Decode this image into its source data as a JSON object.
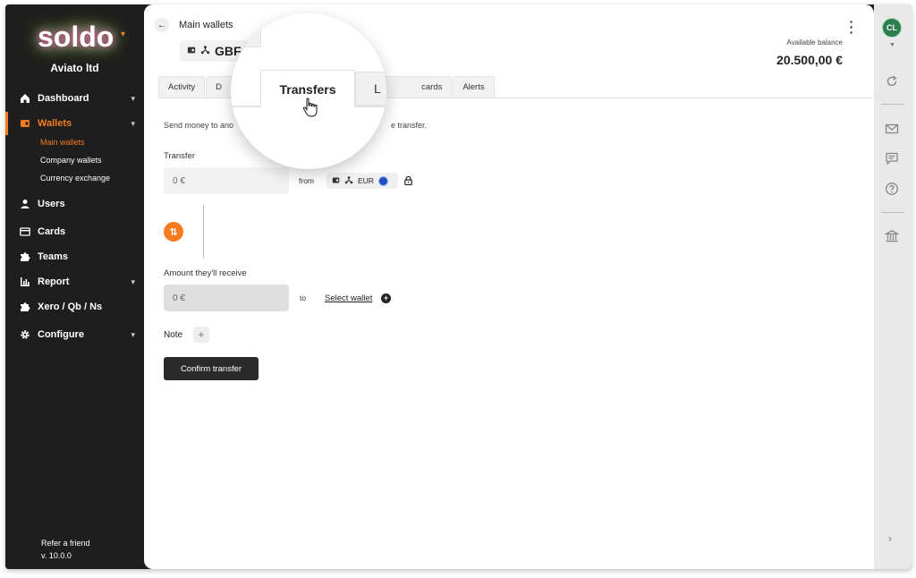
{
  "sidebar": {
    "logo_text": "soldo",
    "company": "Aviato ltd",
    "items": [
      {
        "label": "Dashboard",
        "icon": "home-icon"
      },
      {
        "label": "Wallets",
        "icon": "wallet-icon"
      },
      {
        "label": "Users",
        "icon": "user-icon"
      },
      {
        "label": "Cards",
        "icon": "card-icon"
      },
      {
        "label": "Teams",
        "icon": "puzzle-icon"
      },
      {
        "label": "Report",
        "icon": "bar-chart-icon"
      },
      {
        "label": "Xero / Qb / Ns",
        "icon": "puzzle-icon"
      },
      {
        "label": "Configure",
        "icon": "gear-icon"
      }
    ],
    "wallet_subitems": [
      "Main wallets",
      "Company wallets",
      "Currency exchange"
    ],
    "refer": "Refer a friend",
    "version": "v. 10.0.0"
  },
  "header": {
    "breadcrumb": "Main wallets",
    "wallet_currency": "GBP",
    "wallet_currency_visible": "GBF",
    "available_label": "Available balance",
    "available_value": "20.500,00 €"
  },
  "tabs": {
    "activity": "Activity",
    "d_partial": "D",
    "cards_partial": "cards",
    "alerts": "Alerts",
    "magnified_left": "Do",
    "magnified_active": "Transfers",
    "magnified_right": "L"
  },
  "form": {
    "intro_left": "Send money to ano",
    "intro_right": "e transfer.",
    "transfer_label": "Transfer",
    "transfer_value": "0 €",
    "from_label": "from",
    "from_currency": "EUR",
    "receive_label": "Amount they'll receive",
    "receive_value": "0 €",
    "to_label": "to",
    "select_wallet": "Select wallet",
    "note_label": "Note",
    "confirm_label": "Confirm transfer"
  },
  "user": {
    "initials": "CL"
  },
  "colors": {
    "accent": "#f47b20",
    "sidebar_bg": "#1e1e1e",
    "rail_bg": "#e9e9e9",
    "avatar_bg": "#2e7d4f"
  }
}
